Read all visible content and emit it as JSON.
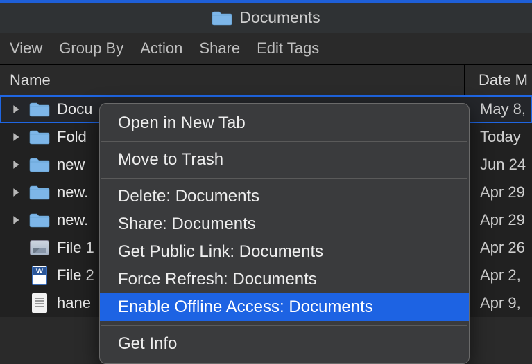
{
  "title": "Documents",
  "toolbar": {
    "view": "View",
    "group_by": "Group By",
    "action": "Action",
    "share": "Share",
    "edit_tags": "Edit Tags"
  },
  "columns": {
    "name": "Name",
    "date": "Date M"
  },
  "rows": [
    {
      "name": "Docu",
      "date": "May 8,",
      "kind": "folder",
      "disclose": true,
      "selected": true
    },
    {
      "name": "Fold",
      "date": "Today",
      "kind": "folder",
      "disclose": true,
      "selected": false
    },
    {
      "name": "new",
      "date": "Jun 24",
      "kind": "folder",
      "disclose": true,
      "selected": false
    },
    {
      "name": "new.",
      "date": "Apr 29",
      "kind": "folder",
      "disclose": true,
      "selected": false
    },
    {
      "name": "new.",
      "date": "Apr 29",
      "kind": "folder",
      "disclose": true,
      "selected": false
    },
    {
      "name": "File 1",
      "date": "Apr 26",
      "kind": "image",
      "disclose": false,
      "selected": false
    },
    {
      "name": "File 2",
      "date": "Apr 2,",
      "kind": "worddoc",
      "disclose": false,
      "selected": false
    },
    {
      "name": "hane",
      "date": "Apr 9,",
      "kind": "text",
      "disclose": false,
      "selected": false
    }
  ],
  "context_menu": {
    "groups": [
      [
        "Open in New Tab"
      ],
      [
        "Move to Trash"
      ],
      [
        "Delete: Documents",
        "Share: Documents",
        "Get Public Link: Documents",
        "Force Refresh: Documents",
        "Enable Offline Access: Documents"
      ],
      [
        "Get Info"
      ]
    ],
    "highlighted": "Enable Offline Access: Documents"
  },
  "colors": {
    "accent": "#1d63e3",
    "folder": "#7db6e8"
  }
}
